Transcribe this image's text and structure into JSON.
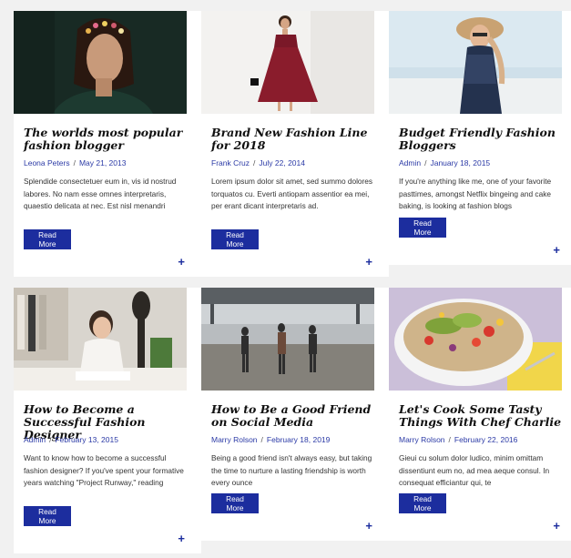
{
  "posts": [
    {
      "title": "The worlds most popular fashion blogger",
      "author": "Leona Peters",
      "date": "May 21, 2013",
      "excerpt": "Splendide consectetuer eum in, vis id nostrud labores. No nam esse omnes interpretaris, quaestio delicata at nec. Est nisl menandri",
      "button": "Read More",
      "plus": "+"
    },
    {
      "title": "Brand New Fashion Line for 2018",
      "author": "Frank Cruz",
      "date": "July 22, 2014",
      "excerpt": "Lorem ipsum dolor sit amet, sed summo dolores torquatos cu. Everti antiopam assentior ea mei, per erant dicant interpretaris ad.",
      "button": "Read More",
      "plus": "+"
    },
    {
      "title": "Budget Friendly Fashion Bloggers",
      "author": "Admin",
      "date": "January 18, 2015",
      "excerpt": "If you're anything like me, one of your favorite pasttimes, amongst Netflix bingeing and cake baking, is looking at fashion blogs",
      "button": "Read More",
      "plus": "+"
    },
    {
      "title": "How to Become a Successful Fashion Designer",
      "author": "Admin",
      "date": "February 13, 2015",
      "excerpt": "Want to know how to become a successful fashion designer? If you've spent your formative years watching \"Project Runway,\" reading",
      "button": "Read More",
      "plus": "+"
    },
    {
      "title": "How to Be a Good Friend on Social Media",
      "author": "Marry Rolson",
      "date": "February 18, 2019",
      "excerpt": "Being a good friend isn't always easy, but taking the time to nurture a lasting friendship is worth every ounce",
      "button": "Read More",
      "plus": "+"
    },
    {
      "title": "Let's Cook Some Tasty Things With Chef Charlie",
      "author": "Marry Rolson",
      "date": "February 22, 2016",
      "excerpt": "Gieui cu solum dolor ludico, minim omittam dissentiunt eum no, ad mea aeque consul. In consequat efficiantur qui, te",
      "button": "Read More",
      "plus": "+"
    }
  ]
}
